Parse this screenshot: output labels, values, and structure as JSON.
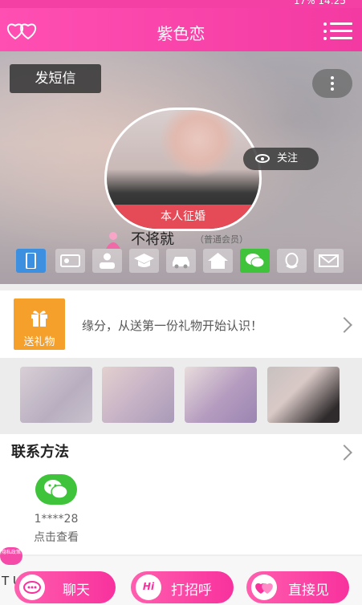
{
  "status_bar": {
    "text": "17%  14:25"
  },
  "header": {
    "title": "紫色恋",
    "logo_label": "紫色恋",
    "logo_icon": "hearts-logo-icon",
    "menu_icon": "list-menu-icon"
  },
  "profile": {
    "send_sms_label": "发短信",
    "more_icon": "vertical-dots-icon",
    "avatar_tag": "本人征婚",
    "follow_label": "关注",
    "username": "不将就",
    "member_level": "（普通会员）",
    "verify_icons": [
      "phone-icon",
      "id-card-icon",
      "person-icon",
      "graduation-cap-icon",
      "car-icon",
      "house-icon",
      "wechat-icon",
      "qq-icon",
      "mail-icon"
    ]
  },
  "gift": {
    "button_label": "送礼物",
    "text": "缘分，从送第一份礼物开始认识！"
  },
  "contact": {
    "title": "联系方法",
    "wechat_id": "1****28",
    "view_label": "点击查看"
  },
  "privacy_badge": "隐私政策",
  "bottom": {
    "peek_text": "T          UID",
    "chat_label": "聊天",
    "greet_label": "打招呼",
    "greet_badge": "Hi",
    "meet_label": "直接见"
  },
  "colors": {
    "brand_pink": "#f43fa4",
    "gift_orange": "#f6a02c",
    "wechat_green": "#3fc33a",
    "tag_red": "#e54a57"
  }
}
